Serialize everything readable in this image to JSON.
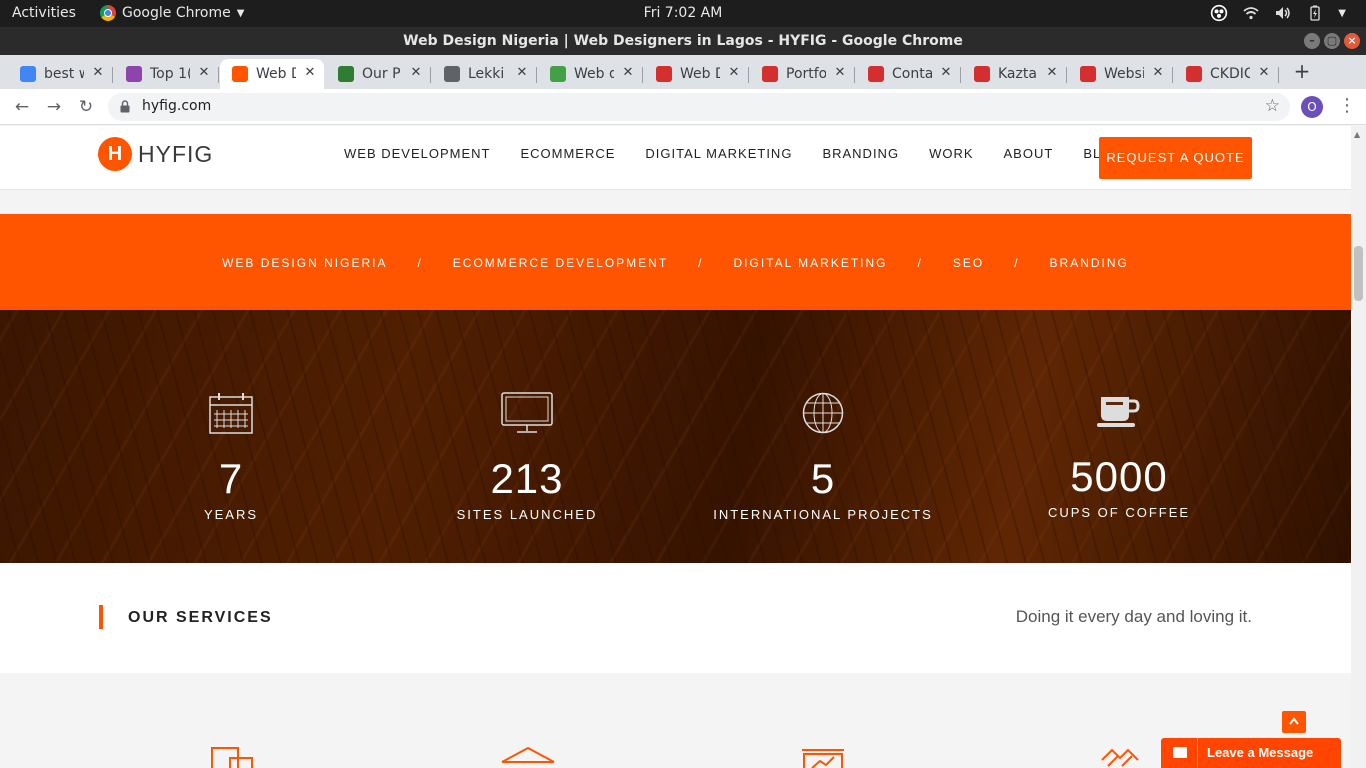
{
  "topbar": {
    "activities": "Activities",
    "app_name": "Google Chrome",
    "clock": "Fri  7:02 AM"
  },
  "window": {
    "title": "Web Design Nigeria | Web Designers in Lagos - HYFIG - Google Chrome"
  },
  "tabs": [
    {
      "label": "best w",
      "favicon": "google-icon",
      "color": "#4285f4"
    },
    {
      "label": "Top 1(",
      "favicon": "colorful-logo-icon",
      "color": "#8e44ad"
    },
    {
      "label": "Web D",
      "favicon": "hyfig-icon",
      "color": "#ff5400",
      "active": true
    },
    {
      "label": "Our P",
      "favicon": "flag-icon",
      "color": "#2e7d32"
    },
    {
      "label": "Lekki",
      "favicon": "globe-icon",
      "color": "#5f6368"
    },
    {
      "label": "Web d",
      "favicon": "g-icon",
      "color": "#43a047"
    },
    {
      "label": "Web D",
      "favicon": "code-icon",
      "color": "#d32f2f"
    },
    {
      "label": "Portfo",
      "favicon": "code-icon",
      "color": "#d32f2f"
    },
    {
      "label": "Conta",
      "favicon": "code-icon",
      "color": "#d32f2f"
    },
    {
      "label": "Kaztal",
      "favicon": "code-icon",
      "color": "#d32f2f"
    },
    {
      "label": "Websi",
      "favicon": "code-icon",
      "color": "#d32f2f"
    },
    {
      "label": "CKDIC",
      "favicon": "code-icon",
      "color": "#d32f2f"
    }
  ],
  "address": {
    "url": "hyfig.com",
    "profile_initial": "O"
  },
  "site": {
    "logo_mark": "H",
    "logo_text": "HYFIG",
    "nav": [
      "WEB DEVELOPMENT",
      "ECOMMERCE",
      "DIGITAL MARKETING",
      "BRANDING",
      "WORK",
      "ABOUT",
      "BLOG"
    ],
    "cta": "REQUEST A QUOTE",
    "accent": "#ff5400"
  },
  "crumbs": [
    "WEB DESIGN NIGERIA",
    "ECOMMERCE DEVELOPMENT",
    "DIGITAL MARKETING",
    "SEO",
    "BRANDING"
  ],
  "crumb_sep": "/",
  "stats": [
    {
      "value": "7",
      "label": "YEARS",
      "icon": "calendar-icon"
    },
    {
      "value": "213",
      "label": "SITES LAUNCHED",
      "icon": "monitor-icon"
    },
    {
      "value": "5",
      "label": "INTERNATIONAL PROJECTS",
      "icon": "globe-icon"
    },
    {
      "value": "5000",
      "label": "CUPS OF COFFEE",
      "icon": "coffee-cup-icon"
    }
  ],
  "services": {
    "title": "OUR SERVICES",
    "tagline": "Doing it every day and loving it."
  },
  "chat": {
    "label": "Leave a Message"
  }
}
